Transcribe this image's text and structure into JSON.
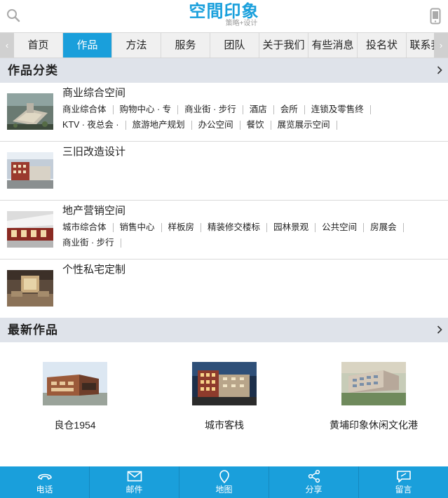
{
  "header": {
    "logo_name": "空間印象",
    "logo_tagline": "策略+设计"
  },
  "nav": {
    "tabs": [
      {
        "label": "首页"
      },
      {
        "label": "作品"
      },
      {
        "label": "方法"
      },
      {
        "label": "服务"
      },
      {
        "label": "团队"
      },
      {
        "label": "关于我们"
      },
      {
        "label": "有些消息"
      },
      {
        "label": "投名状"
      },
      {
        "label": "联系我们"
      }
    ],
    "active_tab": "作品",
    "left_arrow": "‹",
    "right_arrow": "›"
  },
  "categories_section": {
    "title": "作品分类",
    "items": [
      {
        "name": "商业综合空间",
        "subs": [
          "商业综合体",
          "购物中心 · 专",
          "商业街 · 步行",
          "酒店",
          "会所",
          "连锁及零售终",
          "KTV · 夜总会 ·",
          "旅游地产规划",
          "办公空间",
          "餐饮",
          "展览展示空间"
        ]
      },
      {
        "name": "三旧改造设计",
        "subs": []
      },
      {
        "name": "地产营销空间",
        "subs": [
          "城市综合体",
          "销售中心",
          "样板房",
          "精装修交楼标",
          "园林景观",
          "公共空间",
          "房展会",
          "商业街 · 步行"
        ]
      },
      {
        "name": "个性私宅定制",
        "subs": []
      }
    ]
  },
  "latest_section": {
    "title": "最新作品",
    "items": [
      {
        "name": "良仓1954"
      },
      {
        "name": "城市客栈"
      },
      {
        "name": "黄埔印象休闲文化港"
      }
    ]
  },
  "bottom_bar": {
    "items": [
      {
        "label": "电话",
        "icon": "phone-icon"
      },
      {
        "label": "邮件",
        "icon": "mail-icon"
      },
      {
        "label": "地图",
        "icon": "map-pin-icon"
      },
      {
        "label": "分享",
        "icon": "share-icon"
      },
      {
        "label": "留言",
        "icon": "message-icon"
      }
    ]
  },
  "colors": {
    "accent": "#1a9fdb",
    "section_header_bg": "#dfe3ea",
    "nav_bg": "#f0f0f0"
  }
}
